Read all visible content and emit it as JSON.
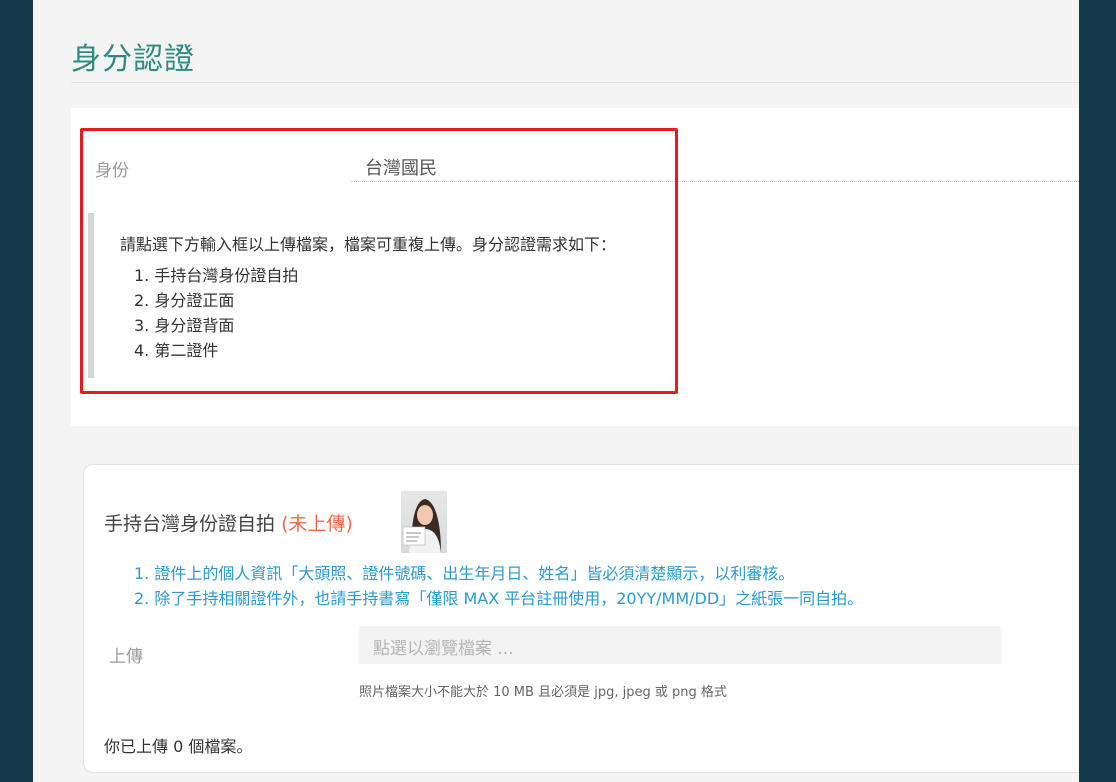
{
  "page": {
    "title": "身分認證"
  },
  "identity": {
    "label": "身份",
    "value": "台灣國民"
  },
  "note": {
    "intro": "請點選下方輸入框以上傳檔案，檔案可重複上傳。身分認證需求如下：",
    "items": [
      "1. 手持台灣身份證自拍",
      "2. 身分證正面",
      "3. 身分證背面",
      "4. 第二證件"
    ]
  },
  "selfie_section": {
    "title": "手持台灣身份證自拍",
    "status": "(未上傳)",
    "requirements": [
      "1. 證件上的個人資訊「大頭照、證件號碼、出生年月日、姓名」皆必須清楚顯示，以利審核。",
      "2. 除了手持相關證件外，也請手持書寫「僅限 MAX 平台註冊使用，20YY/MM/DD」之紙張一同自拍。"
    ],
    "upload_label": "上傳",
    "upload_placeholder": "點選以瀏覽檔案 ...",
    "upload_hint": "照片檔案大小不能大於 10 MB 且必須是 jpg, jpeg 或 png 格式",
    "uploaded_count": "你已上傳 0 個檔案。"
  },
  "colors": {
    "sidebar": "#13394b",
    "title_teal": "#2e8b80",
    "highlight_red": "#e81b1b",
    "status_orange": "#ef6b4a",
    "link_blue": "#2a9bd3"
  }
}
